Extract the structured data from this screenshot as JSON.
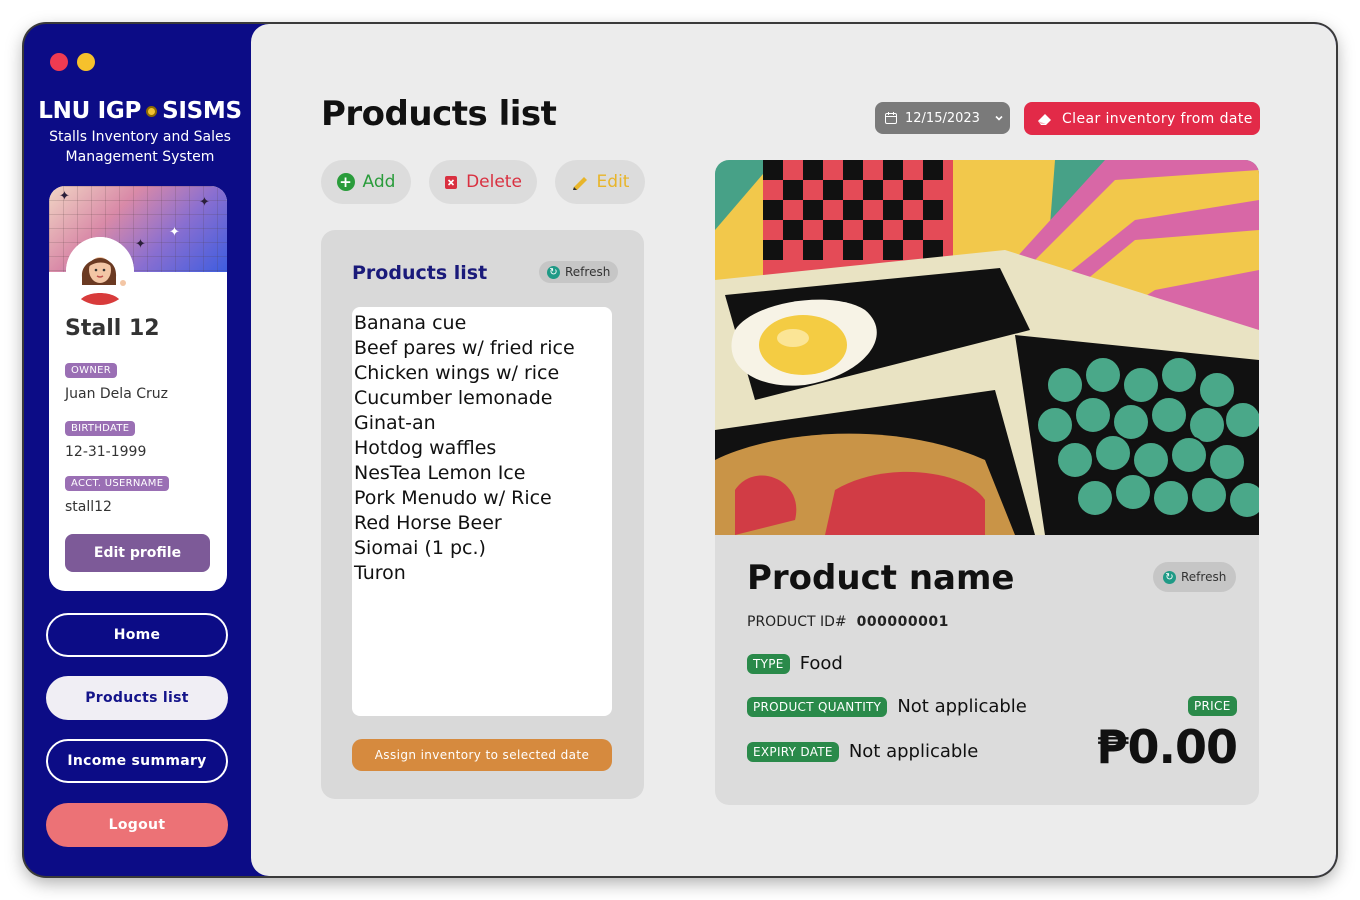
{
  "brand": {
    "title_left": "LNU IGP",
    "title_right": "SISMS",
    "subtitle_line1": "Stalls Inventory and Sales",
    "subtitle_line2": "Management System"
  },
  "profile": {
    "stall_name": "Stall 12",
    "owner_label": "OWNER",
    "owner_value": "Juan Dela Cruz",
    "birthdate_label": "BIRTHDATE",
    "birthdate_value": "12-31-1999",
    "username_label": "ACCT. USERNAME",
    "username_value": "stall12",
    "edit_label": "Edit profile"
  },
  "nav": {
    "home": "Home",
    "products": "Products list",
    "income": "Income summary",
    "logout": "Logout"
  },
  "header": {
    "title": "Products list",
    "date": "12/15/2023",
    "clear_label": "Clear inventory from date"
  },
  "actions": {
    "add": "Add",
    "delete": "Delete",
    "edit": "Edit"
  },
  "list_panel": {
    "title": "Products list",
    "refresh": "Refresh",
    "items": [
      "Banana cue",
      "Beef pares w/ fried rice",
      "Chicken wings w/ rice",
      "Cucumber lemonade",
      "Ginat-an",
      "Hotdog waffles",
      "NesTea Lemon Ice",
      "Pork Menudo w/ Rice",
      "Red Horse Beer",
      "Siomai (1 pc.)",
      "Turon"
    ],
    "assign_label": "Assign inventory to selected date"
  },
  "detail": {
    "product_name": "Product name",
    "refresh": "Refresh",
    "id_label": "PRODUCT ID#",
    "id_value": "000000001",
    "type_label": "TYPE",
    "type_value": "Food",
    "qty_label": "PRODUCT QUANTITY",
    "qty_value": "Not applicable",
    "expiry_label": "EXPIRY DATE",
    "expiry_value": "Not applicable",
    "price_label": "PRICE",
    "price_value": "₱0.00"
  },
  "colors": {
    "sidebar": "#0c0c86",
    "accent_red": "#e22a48",
    "tag_purple": "#9a6fb4",
    "tag_green": "#2a8a4a",
    "assign_orange": "#d68a3e",
    "logout_pink": "#ec7276"
  },
  "icons": {
    "date": "calendar-icon",
    "clear": "eraser-icon",
    "add": "plus-circle-icon",
    "delete": "trash-icon",
    "edit": "pencil-icon",
    "refresh": "refresh-icon"
  }
}
